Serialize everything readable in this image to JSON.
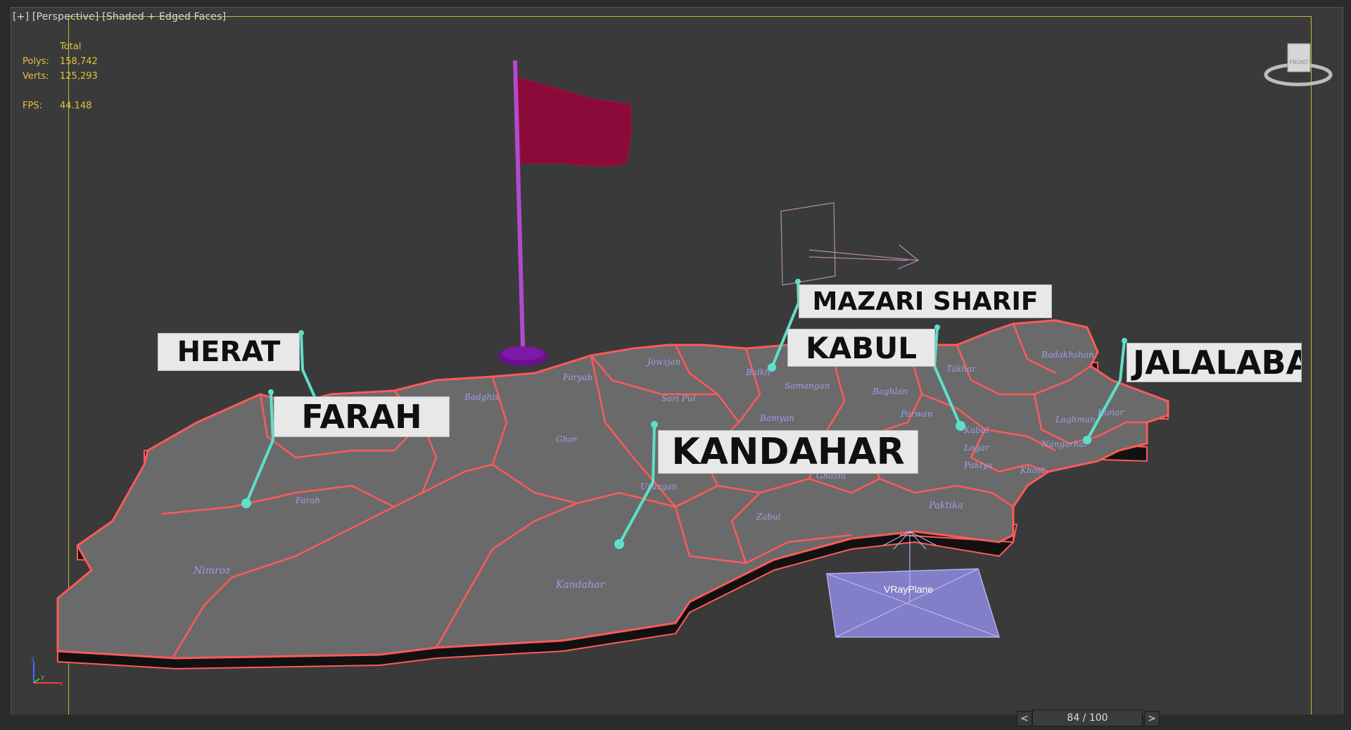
{
  "viewport": {
    "label_parts": [
      "[+]",
      "[Perspective]",
      "[Shaded + Edged Faces]"
    ]
  },
  "stats": {
    "header": "Total",
    "rows": [
      {
        "key": "Polys:",
        "value": "158,742"
      },
      {
        "key": "Verts:",
        "value": "125,293"
      },
      {
        "key": "FPS:",
        "value": "44.148"
      }
    ]
  },
  "scene": {
    "labels": {
      "herat": "HERAT",
      "farah": "FARAH",
      "kandahar": "KANDAHAR",
      "mazari": "MAZARI SHARIF",
      "kabul": "KABUL",
      "jalalabad": "JALALABA"
    },
    "map_labels": {
      "farah": "Farah",
      "nimroz": "Nimroz",
      "kandahar": "Kandahar",
      "zabul": "Zabul",
      "ghazni": "Ghazni",
      "paktika": "Paktika",
      "uruzgan": "Uruzgan",
      "ghor": "Ghor",
      "badghis": "Badghis",
      "faryab": "Faryab",
      "sar_e_pul": "Sari Pul",
      "bamyan": "Bamyan",
      "balkh": "Balkh",
      "samangan": "Samangan",
      "baghlan": "Baghlan",
      "takhar": "Takhar",
      "badakhshan": "Badakhshan",
      "parwan": "Parwan",
      "kabul_prov": "Kabul",
      "logar": "Logar",
      "paktya": "Paktya",
      "khost": "Khost",
      "nangarhar": "Nangarhar",
      "laghman": "Laghman",
      "kunar": "Kunar",
      "jowzjan": "Jowzjan"
    },
    "vray_plane_label": "VRayPlane",
    "colors": {
      "land": "#6a6a6a",
      "border": "#ff5a5a",
      "flag": "#8c0a3a",
      "pole": "#b44ad0",
      "leader": "#5ee0c8",
      "vray": "#8a86d8"
    }
  },
  "viewcube": {
    "label": "FRONT"
  },
  "timeline": {
    "prev": "<",
    "next": ">",
    "frame": "84 / 100"
  },
  "axis": {
    "x": "x",
    "y": "y",
    "z": "z"
  }
}
